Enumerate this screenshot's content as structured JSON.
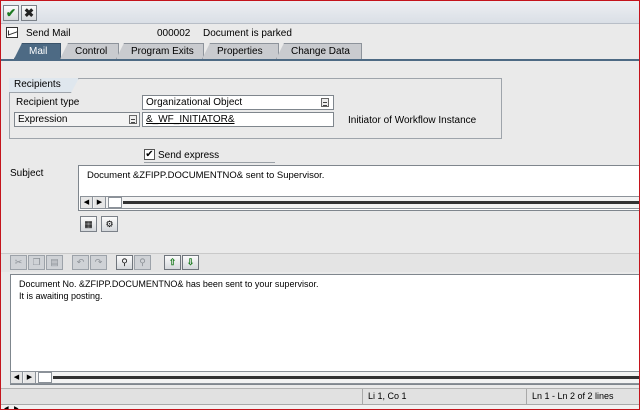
{
  "toolbar": {
    "ok_icon": "✔",
    "cancel_icon": "✖"
  },
  "header": {
    "step_type": "Send Mail",
    "step_number": "000002",
    "step_description": "Document is parked"
  },
  "tabs": [
    {
      "label": "Mail",
      "active": true
    },
    {
      "label": "Control",
      "active": false
    },
    {
      "label": "Program Exits",
      "active": false
    },
    {
      "label": "Properties",
      "active": false
    },
    {
      "label": "Change Data",
      "active": false
    }
  ],
  "recipients": {
    "group_title": "Recipients",
    "type_label": "Recipient type",
    "type_value": "Organizational Object",
    "expression_label": "Expression",
    "expression_value": "&_WF_INITIATOR&",
    "expression_description": "Initiator of Workflow Instance"
  },
  "send_express": {
    "label": "Send express",
    "checked": true,
    "mark": "✔"
  },
  "subject": {
    "label": "Subject",
    "value": "Document &ZFIPP.DOCUMENTNO& sent to Supervisor."
  },
  "editor": {
    "lines": [
      "Document  No. &ZFIPP.DOCUMENTNO& has been sent to your supervisor.",
      "It is awaiting posting."
    ]
  },
  "status": {
    "cursor": "Li 1, Co 1",
    "lines": "Ln 1 - Ln 2 of 2 lines"
  },
  "colors": {
    "tab_active": "#4d6a84",
    "frame": "#c4141c"
  }
}
